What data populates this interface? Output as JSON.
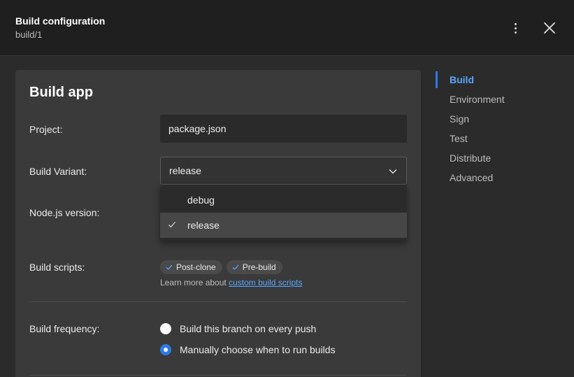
{
  "header": {
    "title": "Build configuration",
    "subtitle": "build/1"
  },
  "panel": {
    "title": "Build app",
    "project": {
      "label": "Project:",
      "value": "package.json"
    },
    "variant": {
      "label": "Build Variant:",
      "value": "release",
      "options": [
        {
          "label": "debug",
          "selected": false
        },
        {
          "label": "release",
          "selected": true
        }
      ]
    },
    "node": {
      "label": "Node.js version:"
    },
    "scripts": {
      "label": "Build scripts:",
      "chips": [
        "Post-clone",
        "Pre-build"
      ],
      "learn_prefix": "Learn more about",
      "learn_link": "custom build scripts"
    },
    "frequency": {
      "label": "Build frequency:",
      "options": [
        {
          "label": "Build this branch on every push",
          "selected": false
        },
        {
          "label": "Manually choose when to run builds",
          "selected": true
        }
      ]
    }
  },
  "nav": {
    "items": [
      {
        "label": "Build",
        "active": true
      },
      {
        "label": "Environment",
        "active": false
      },
      {
        "label": "Sign",
        "active": false
      },
      {
        "label": "Test",
        "active": false
      },
      {
        "label": "Distribute",
        "active": false
      },
      {
        "label": "Advanced",
        "active": false
      }
    ]
  },
  "colors": {
    "accent": "#2f7ae5",
    "link": "#5aa7ff",
    "background": "#2b2b2b",
    "panel": "#3a3a3a"
  },
  "icons": {
    "menu": "more-vertical-icon",
    "close": "close-icon",
    "chevron": "chevron-down-icon",
    "check": "check-icon"
  }
}
